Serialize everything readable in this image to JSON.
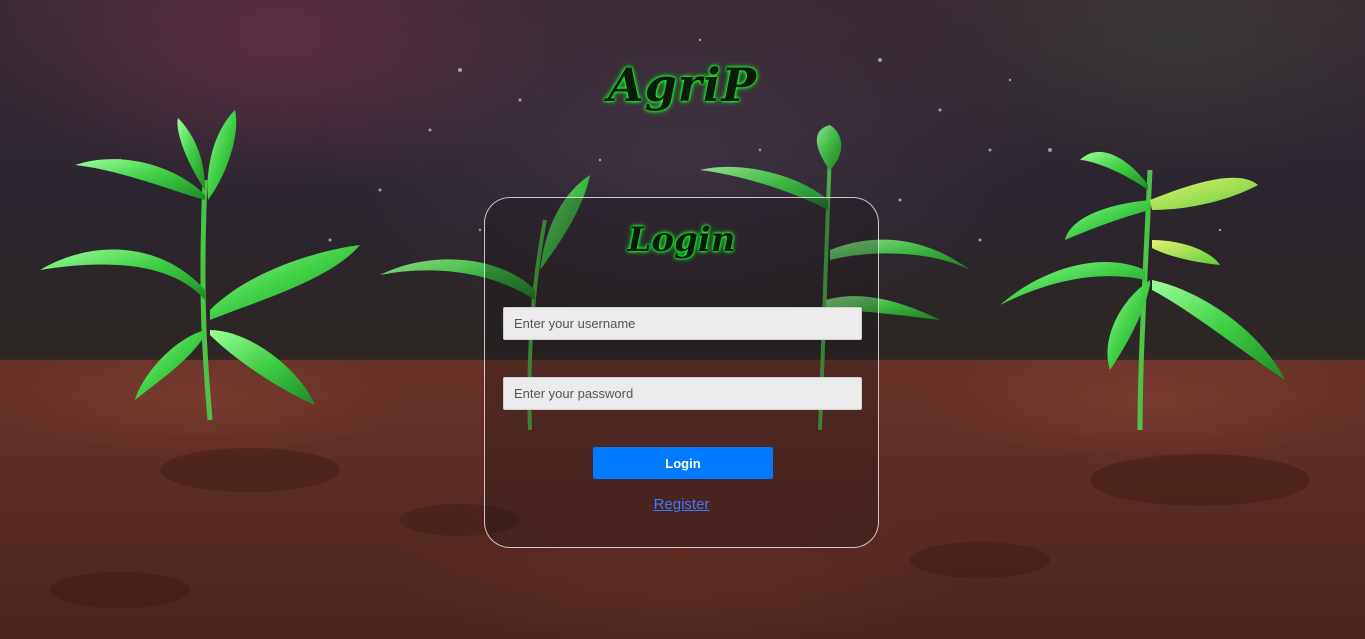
{
  "logo": {
    "text": "AgriP"
  },
  "login_form": {
    "title": "Login",
    "username_placeholder": "Enter your username",
    "password_placeholder": "Enter your password",
    "submit_label": "Login",
    "register_label": "Register"
  },
  "colors": {
    "accent_button": "#007bff",
    "link": "#3b7bff",
    "logo_glow": "#16ff2a"
  }
}
